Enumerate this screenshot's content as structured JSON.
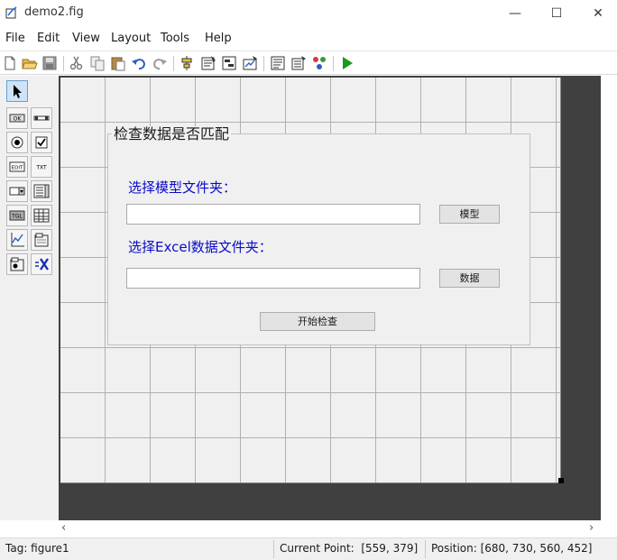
{
  "window": {
    "title": "demo2.fig",
    "controls": {
      "minimize": "—",
      "maximize": "☐",
      "close": "✕"
    }
  },
  "menu": [
    "File",
    "Edit",
    "View",
    "Layout",
    "Tools",
    "Help"
  ],
  "toolbar": {
    "icons": [
      "new-icon",
      "open-icon",
      "save-icon",
      "cut-icon",
      "copy-icon",
      "paste-icon",
      "undo-icon",
      "redo-icon",
      "align-icon",
      "menu-editor-icon",
      "tab-order-icon",
      "toolbar-editor-icon",
      "mfile-editor-icon",
      "property-inspector-icon",
      "object-browser-icon",
      "run-icon"
    ]
  },
  "palette": {
    "tools": [
      "select",
      "pushbutton",
      "slider",
      "radiobutton",
      "checkbox",
      "edittext",
      "statictext",
      "popupmenu",
      "listbox",
      "togglebutton",
      "table",
      "axes",
      "panel",
      "buttongroup",
      "activex"
    ],
    "labels": {
      "pushbutton": "OK",
      "edittext": "EDIT",
      "statictext": "TXT",
      "togglebutton": "TGL"
    }
  },
  "figure": {
    "panel_title": "检查数据是否匹配",
    "model_label": "选择模型文件夹：",
    "model_input": "",
    "model_button": "模型",
    "excel_label": "选择Excel数据文件夹：",
    "excel_input": "",
    "data_button": "数据",
    "start_button": "开始检查"
  },
  "scroll": {
    "left": "‹",
    "right": "›"
  },
  "status": {
    "tag": "Tag: figure1",
    "current_point": "Current Point:  [559, 379]",
    "position": "Position: [680, 730, 560, 452]"
  },
  "colors": {
    "accent_blue": "#0a0ac8",
    "canvas_dark": "#404040",
    "figure_bg": "#f0f0f0",
    "run_green": "#1a9a1a"
  }
}
